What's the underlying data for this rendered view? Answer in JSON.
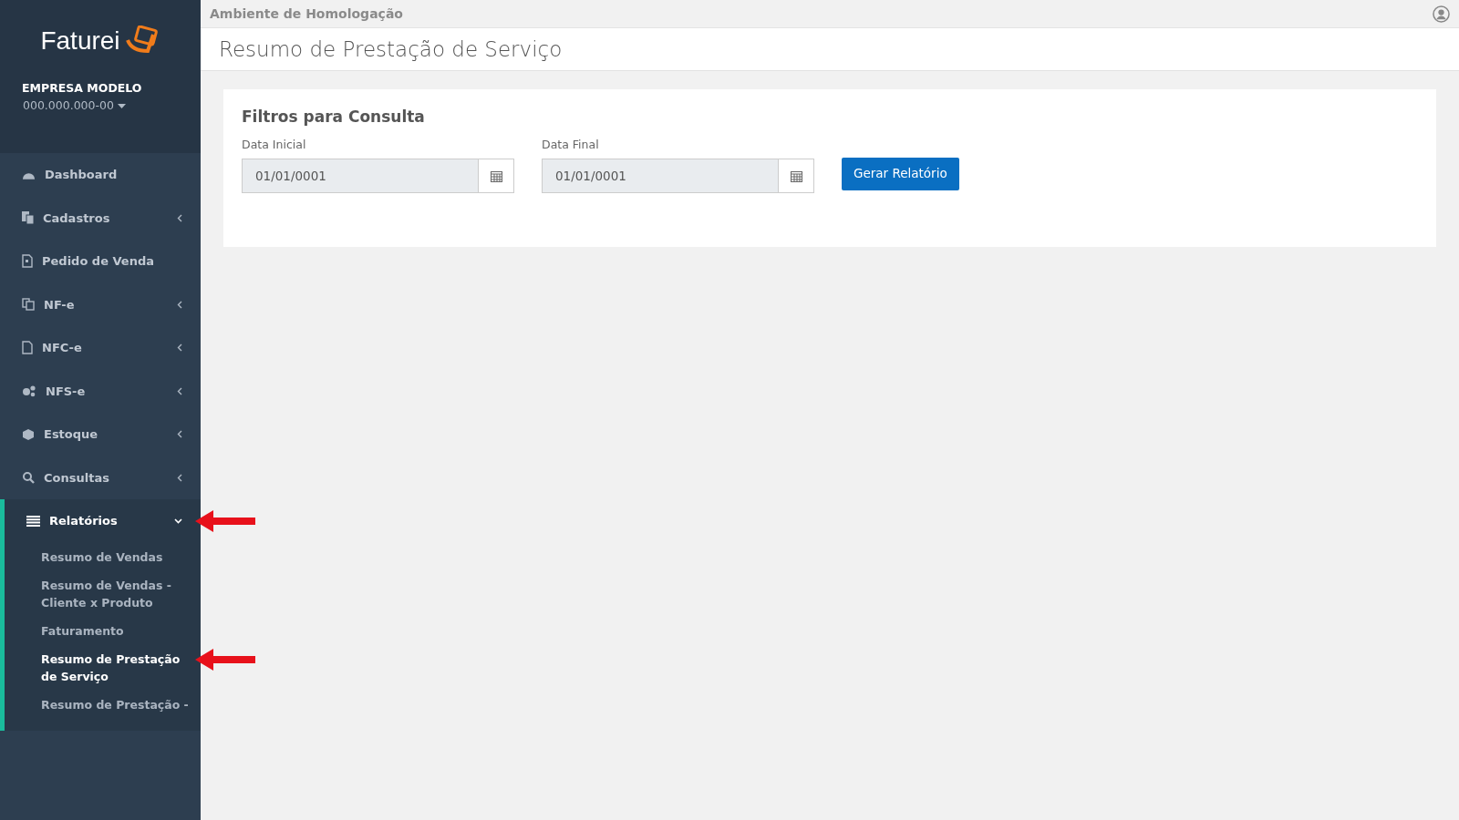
{
  "sidebar": {
    "logo": "Faturei",
    "company": "EMPRESA MODELO",
    "document": "000.000.000-00",
    "items": [
      {
        "label": "Dashboard",
        "selected": false
      },
      {
        "label": "Cadastros",
        "selected": false,
        "expanded": false
      },
      {
        "label": "Pedido de Venda",
        "selected": false
      },
      {
        "label": "NF-e",
        "selected": false,
        "expanded": false
      },
      {
        "label": "NFC-e",
        "selected": false,
        "expanded": false
      },
      {
        "label": "NFS-e",
        "selected": false,
        "expanded": false
      },
      {
        "label": "Estoque",
        "selected": false,
        "expanded": false
      },
      {
        "label": "Consultas",
        "selected": false,
        "expanded": false
      },
      {
        "label": "Relatórios",
        "selected": true,
        "expanded": true,
        "annotated": true,
        "children": [
          {
            "label": "Resumo de Vendas",
            "selected": false
          },
          {
            "label": "Resumo de Vendas - Cliente x Produto",
            "selected": false
          },
          {
            "label": "Faturamento",
            "selected": false
          },
          {
            "label": "Resumo de Prestação de Serviço",
            "selected": true,
            "annotated": true
          },
          {
            "label": "Resumo de Prestação -",
            "selected": false
          }
        ]
      }
    ]
  },
  "topbar": {
    "environment": "Ambiente de Homologação"
  },
  "page_title": "Resumo de Prestação de Serviço",
  "filters": {
    "title": "Filtros para Consulta",
    "fields": [
      {
        "label": "Data Inicial",
        "value": "01/01/0001"
      },
      {
        "label": "Data Final",
        "value": "01/01/0001"
      }
    ],
    "button": "Gerar Relatório"
  }
}
